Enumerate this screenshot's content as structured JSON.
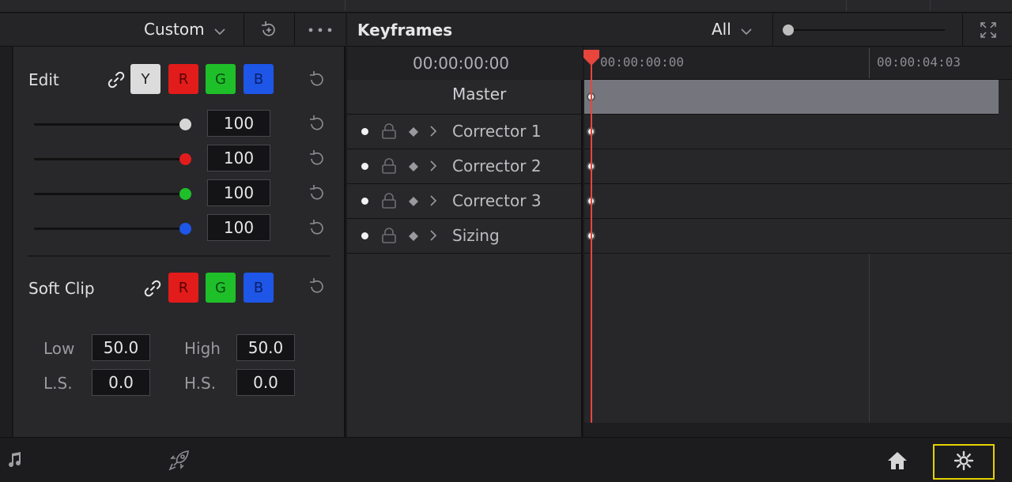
{
  "color_panel": {
    "mode_select": "Custom",
    "edit_label": "Edit",
    "channels": [
      "Y",
      "R",
      "G",
      "B"
    ],
    "slider_values": [
      "100",
      "100",
      "100",
      "100"
    ],
    "soft_clip_label": "Soft Clip",
    "soft_clip_channels": [
      "R",
      "G",
      "B"
    ],
    "low_label": "Low",
    "low_value": "50.0",
    "high_label": "High",
    "high_value": "50.0",
    "ls_label": "L.S.",
    "ls_value": "0.0",
    "hs_label": "H.S.",
    "hs_value": "0.0"
  },
  "keyframes": {
    "title": "Keyframes",
    "filter": "All",
    "timecode": "00:00:00:00",
    "ruler_start": "00:00:00:00",
    "ruler_mark": "00:00:04:03",
    "tracks": [
      "Master",
      "Corrector 1",
      "Corrector 2",
      "Corrector 3",
      "Sizing"
    ]
  },
  "colors": {
    "playhead": "#e8453c",
    "highlight": "#e6d200"
  },
  "icons": {
    "mode_dropdown": "chevron-down-icon",
    "reset_all": "reset-icon",
    "more": "more-icon",
    "expand": "expand-icon",
    "music": "music-icon",
    "deliver": "rocket-icon",
    "home": "home-icon",
    "settings": "gear-icon"
  }
}
